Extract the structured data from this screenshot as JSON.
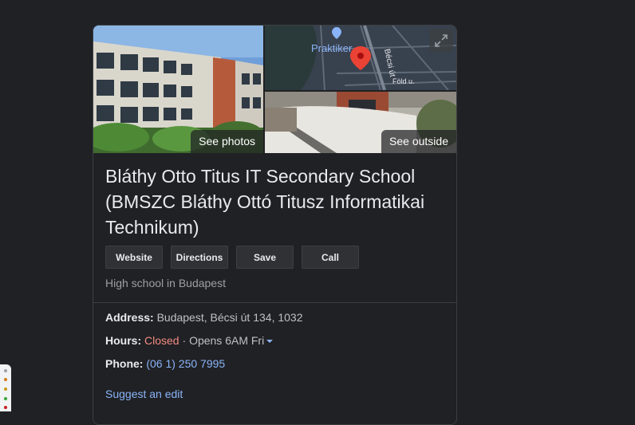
{
  "photos": {
    "see_photos_label": "See photos",
    "see_outside_label": "See outside",
    "map": {
      "place_label": "Praktiker",
      "street_label": "Bécsi út",
      "street2_label": "Föld u."
    }
  },
  "place": {
    "title_line1": "Bláthy Otto Titus IT Secondary School",
    "title_line2": "(BMSZC Bláthy Ottó Titusz Informatikai",
    "title_line3": "Technikum)",
    "category": "High school in Budapest"
  },
  "actions": {
    "website": "Website",
    "directions": "Directions",
    "save": "Save",
    "call": "Call"
  },
  "info": {
    "address_label": "Address:",
    "address_value": "Budapest, Bécsi út 134, 1032",
    "hours_label": "Hours:",
    "hours_status": "Closed",
    "hours_separator": " · ",
    "hours_next": "Opens 6AM Fri",
    "phone_label": "Phone:",
    "phone_value": "(06 1) 250 7995"
  },
  "suggest_edit": "Suggest an edit",
  "colors": {
    "background": "#202124",
    "text": "#e8eaed",
    "muted": "#9aa0a6",
    "link": "#8ab4f8",
    "closed": "#f28b82",
    "map_pin": "#ea4335"
  }
}
